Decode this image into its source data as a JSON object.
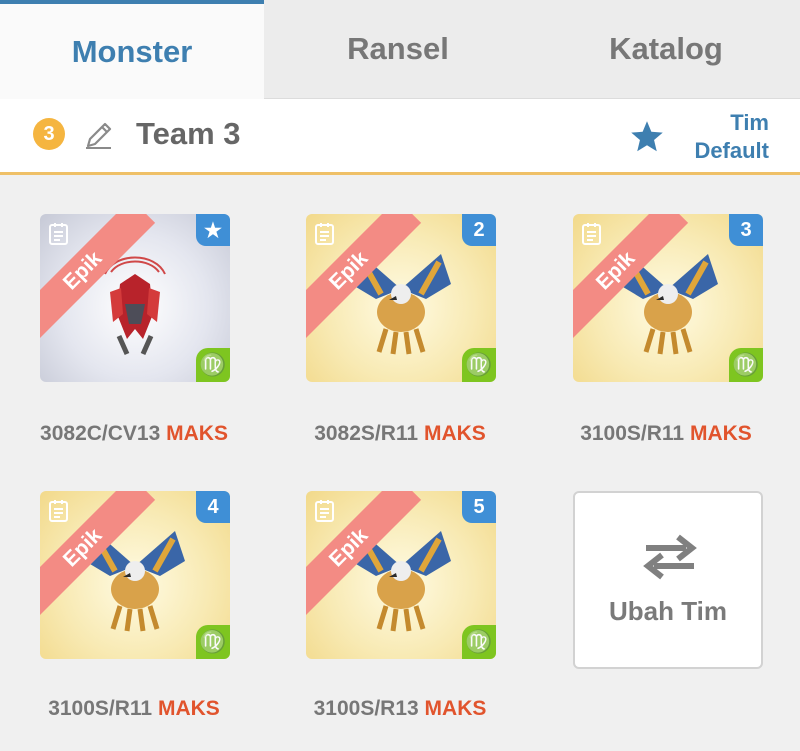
{
  "tabs": [
    {
      "label": "Monster",
      "active": true
    },
    {
      "label": "Ransel",
      "active": false
    },
    {
      "label": "Katalog",
      "active": false
    }
  ],
  "team": {
    "number": "3",
    "name": "Team 3",
    "default_label_line1": "Tim",
    "default_label_line2": "Default"
  },
  "monsters": [
    {
      "rarity": "Epik",
      "corner": "★",
      "zodiac": "♍",
      "code": "3082C/CV13",
      "level": "MAKS",
      "bg": "white"
    },
    {
      "rarity": "Epik",
      "corner": "2",
      "zodiac": "♍",
      "code": "3082S/R11",
      "level": "MAKS",
      "bg": "yellow"
    },
    {
      "rarity": "Epik",
      "corner": "3",
      "zodiac": "♍",
      "code": "3100S/R11",
      "level": "MAKS",
      "bg": "yellow"
    },
    {
      "rarity": "Epik",
      "corner": "4",
      "zodiac": "♍",
      "code": "3100S/R11",
      "level": "MAKS",
      "bg": "yellow"
    },
    {
      "rarity": "Epik",
      "corner": "5",
      "zodiac": "♍",
      "code": "3100S/R13",
      "level": "MAKS",
      "bg": "yellow"
    }
  ],
  "swap": {
    "label": "Ubah Tim",
    "icon": "swap-arrows-icon"
  },
  "colors": {
    "accent": "#3e7fb0",
    "badge": "#f5b540",
    "rarity_ribbon": "#f38b84",
    "corner_blue": "#3f8fd6",
    "zodiac_green": "#7ec520",
    "max_red": "#e1542d",
    "divider": "#efc067"
  }
}
